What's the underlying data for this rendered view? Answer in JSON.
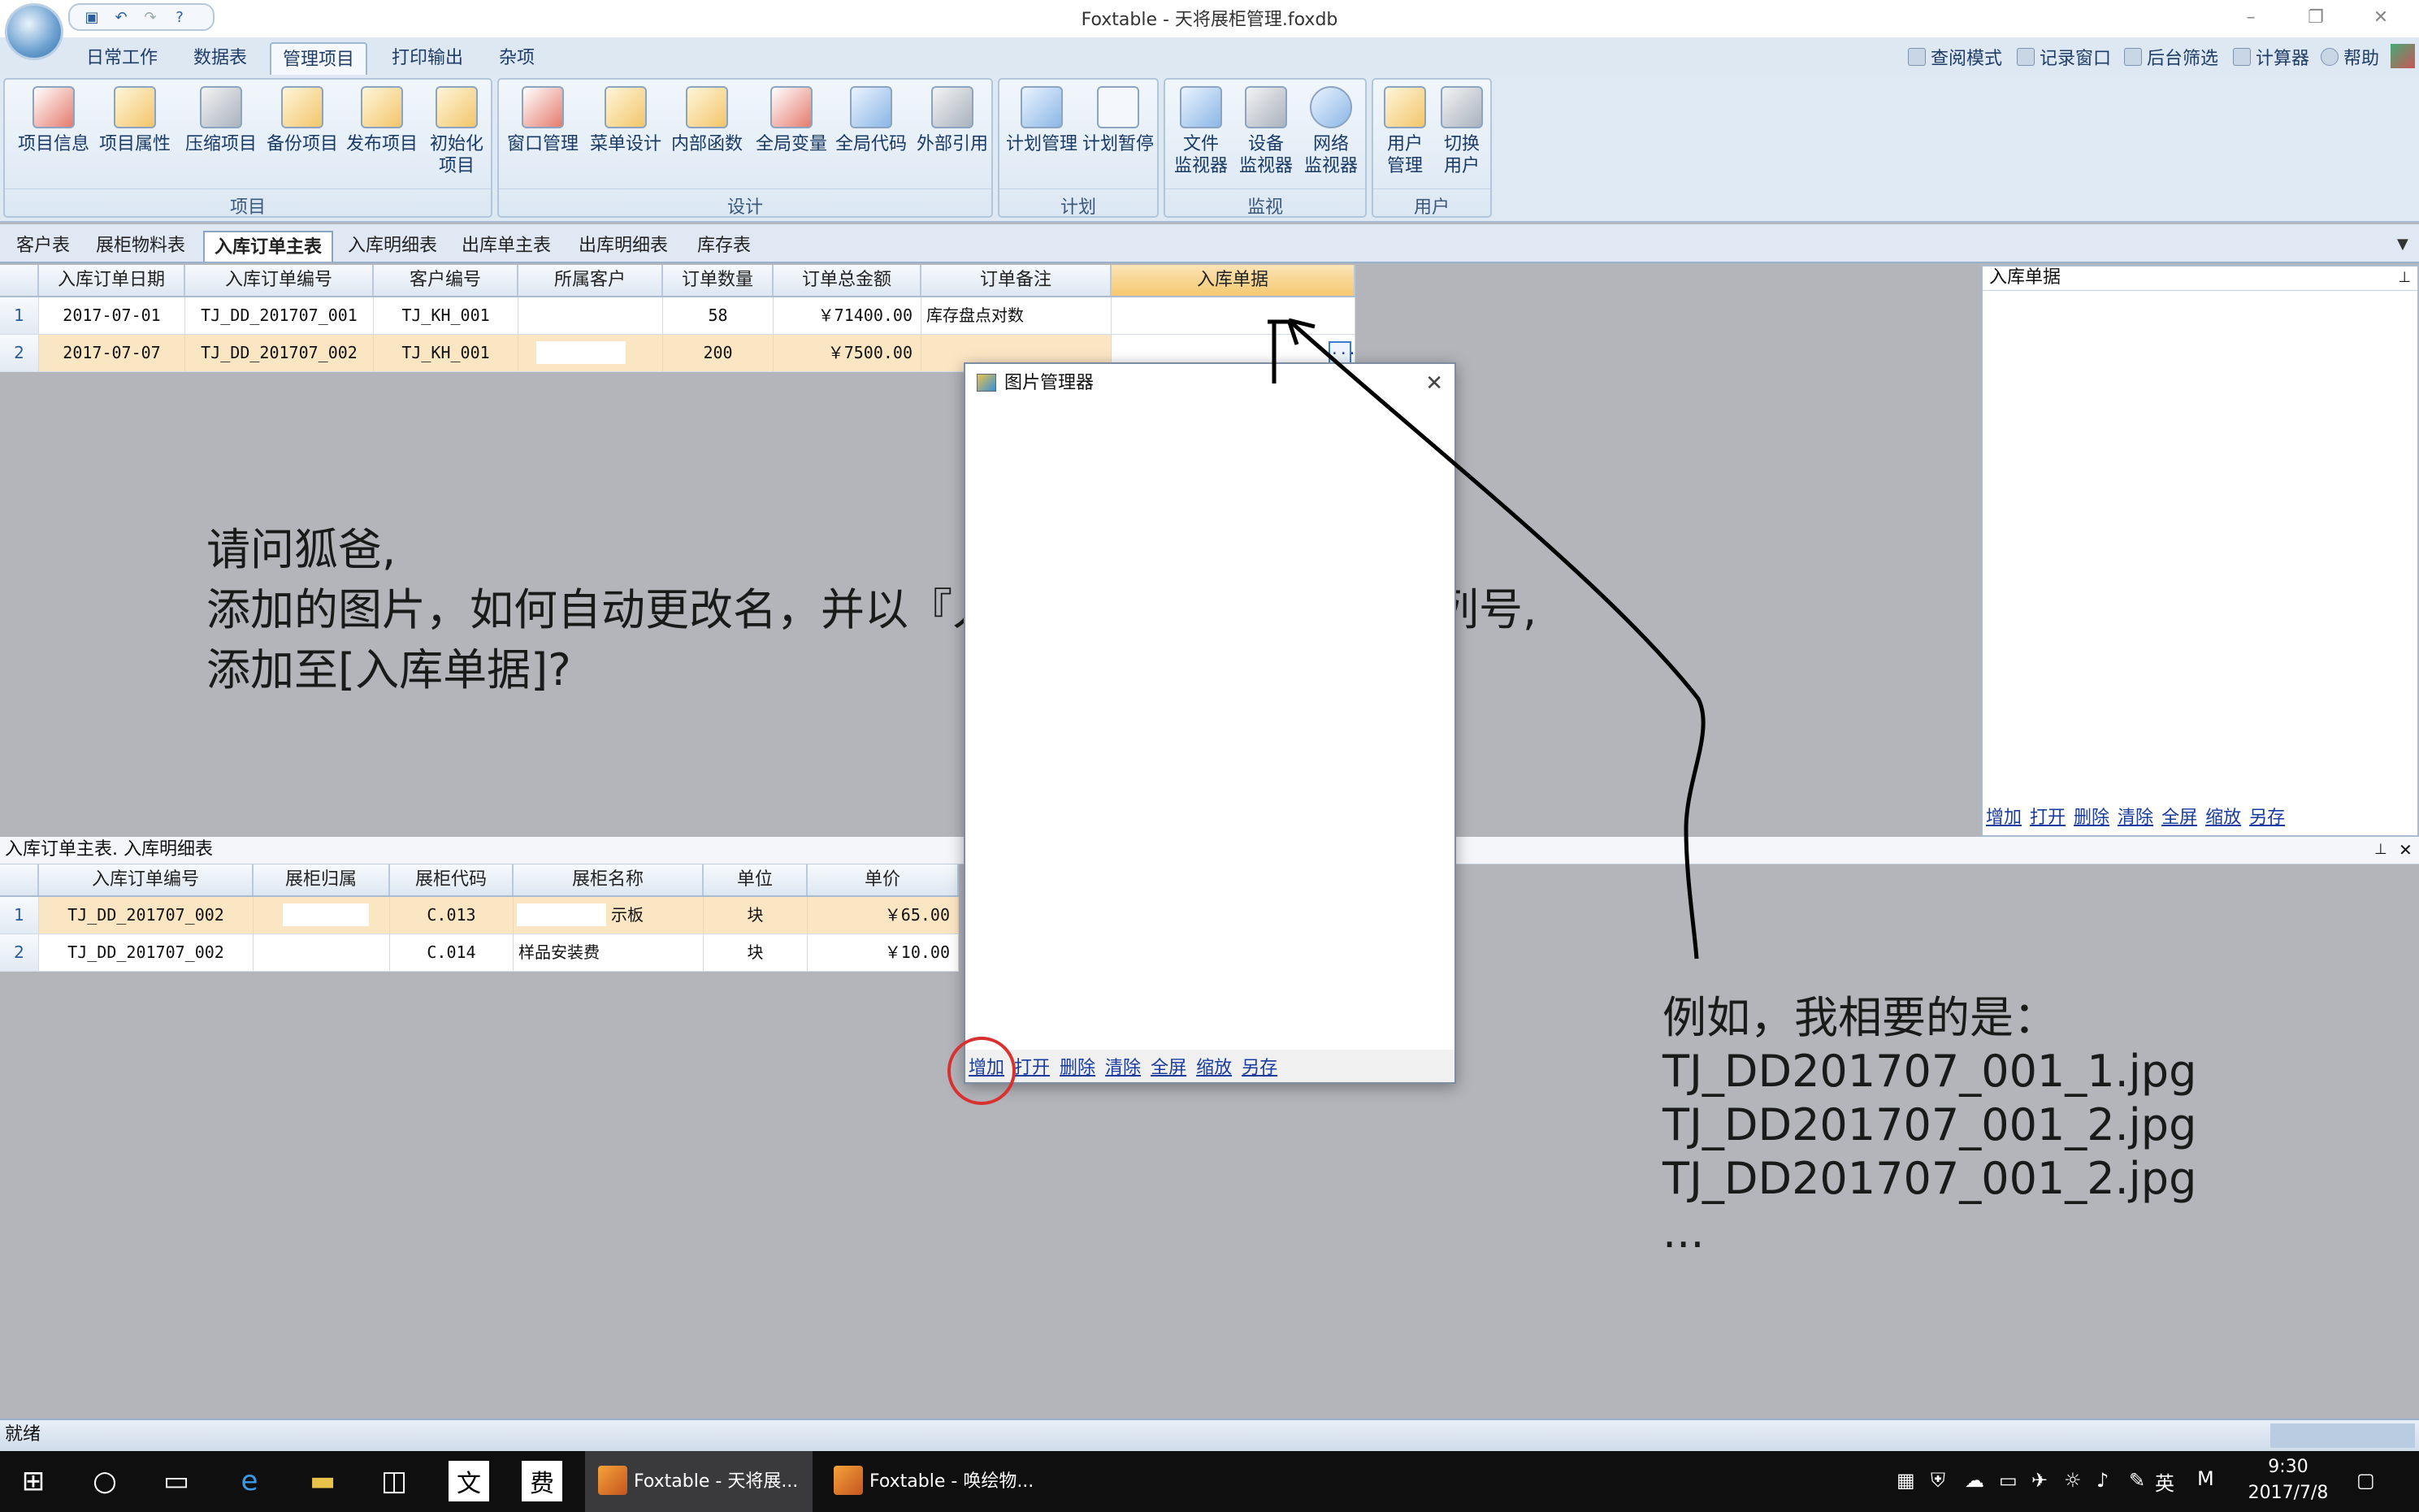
{
  "window": {
    "title": "Foxtable - 天将展柜管理.foxdb"
  },
  "qat": [
    "save-icon",
    "undo-icon",
    "redo-icon",
    "help-icon"
  ],
  "ribbon_tabs": [
    "日常工作",
    "数据表",
    "管理项目",
    "打印输出",
    "杂项"
  ],
  "ribbon_active_tab": "管理项目",
  "ribbon_right": [
    "查阅模式",
    "记录窗口",
    "后台筛选",
    "计算器",
    "帮助"
  ],
  "groups": {
    "project": {
      "label": "项目",
      "buttons": [
        "项目信息",
        "项目属性",
        "压缩项目",
        "备份项目",
        "发布项目",
        "初始化\n项目"
      ]
    },
    "design": {
      "label": "设计",
      "buttons": [
        "窗口管理",
        "菜单设计",
        "内部函数",
        "全局变量",
        "全局代码",
        "外部引用"
      ]
    },
    "plan": {
      "label": "计划",
      "buttons": [
        "计划管理",
        "计划暂停"
      ]
    },
    "monitor": {
      "label": "监视",
      "buttons": [
        "文件\n监视器",
        "设备\n监视器",
        "网络\n监视器"
      ]
    },
    "user": {
      "label": "用户",
      "buttons": [
        "用户\n管理",
        "切换\n用户"
      ]
    }
  },
  "sheet_tabs": [
    "客户表",
    "展柜物料表",
    "入库订单主表",
    "入库明细表",
    "出库单主表",
    "出库明细表",
    "库存表"
  ],
  "sheet_active": "入库订单主表",
  "main_grid": {
    "columns": [
      "入库订单日期",
      "入库订单编号",
      "客户编号",
      "所属客户",
      "订单数量",
      "订单总金额",
      "订单备注",
      "入库单据"
    ],
    "rows": [
      {
        "n": "1",
        "date": "2017-07-01",
        "code": "TJ_DD_201707_001",
        "cust": "TJ_KH_001",
        "owner": "",
        "qty": "58",
        "amount": "￥71400.00",
        "note": "库存盘点对数",
        "doc": ""
      },
      {
        "n": "2",
        "date": "2017-07-07",
        "code": "TJ_DD_201707_002",
        "cust": "TJ_KH_001",
        "owner": "",
        "qty": "200",
        "amount": "￥7500.00",
        "note": "",
        "doc": ""
      }
    ],
    "ellipsis": "..."
  },
  "side_panel": {
    "title": "入库单据",
    "links": [
      "增加",
      "打开",
      "删除",
      "清除",
      "全屏",
      "缩放",
      "另存"
    ]
  },
  "lower_caption": "入库订单主表. 入库明细表",
  "detail_grid": {
    "columns": [
      "入库订单编号",
      "展柜归属",
      "展柜代码",
      "展柜名称",
      "单位",
      "单价"
    ],
    "rows": [
      {
        "n": "1",
        "code": "TJ_DD_201707_002",
        "belong": "",
        "ccode": "C.013",
        "name": "示板",
        "unit": "块",
        "price": "￥65.00"
      },
      {
        "n": "2",
        "code": "TJ_DD_201707_002",
        "belong": "",
        "ccode": "C.014",
        "name": "样品安装费",
        "unit": "块",
        "price": "￥10.00"
      }
    ]
  },
  "dialog": {
    "title": "图片管理器",
    "links": [
      "增加",
      "打开",
      "删除",
      "清除",
      "全屏",
      "缩放",
      "另存"
    ]
  },
  "annotation_question": [
    "请问狐爸,",
    "添加的图片，如何自动更改名，并以『入库订单编号』为名的序列号,",
    "添加至[入库单据]?"
  ],
  "annotation_example": [
    "例如，我相要的是：",
    "TJ_DD201707_001_1.jpg",
    "TJ_DD201707_001_2.jpg",
    "TJ_DD201707_001_2.jpg",
    "..."
  ],
  "status": "就绪",
  "taskbar": {
    "apps": [
      "Foxtable - 天将展...",
      "Foxtable - 唤绘物..."
    ],
    "ime": "英",
    "ime2": "M",
    "time": "9:30",
    "date": "2017/7/8"
  },
  "colors": {
    "accent": "#f5c870",
    "link": "#1a3b9e",
    "circle": "#d93030"
  }
}
